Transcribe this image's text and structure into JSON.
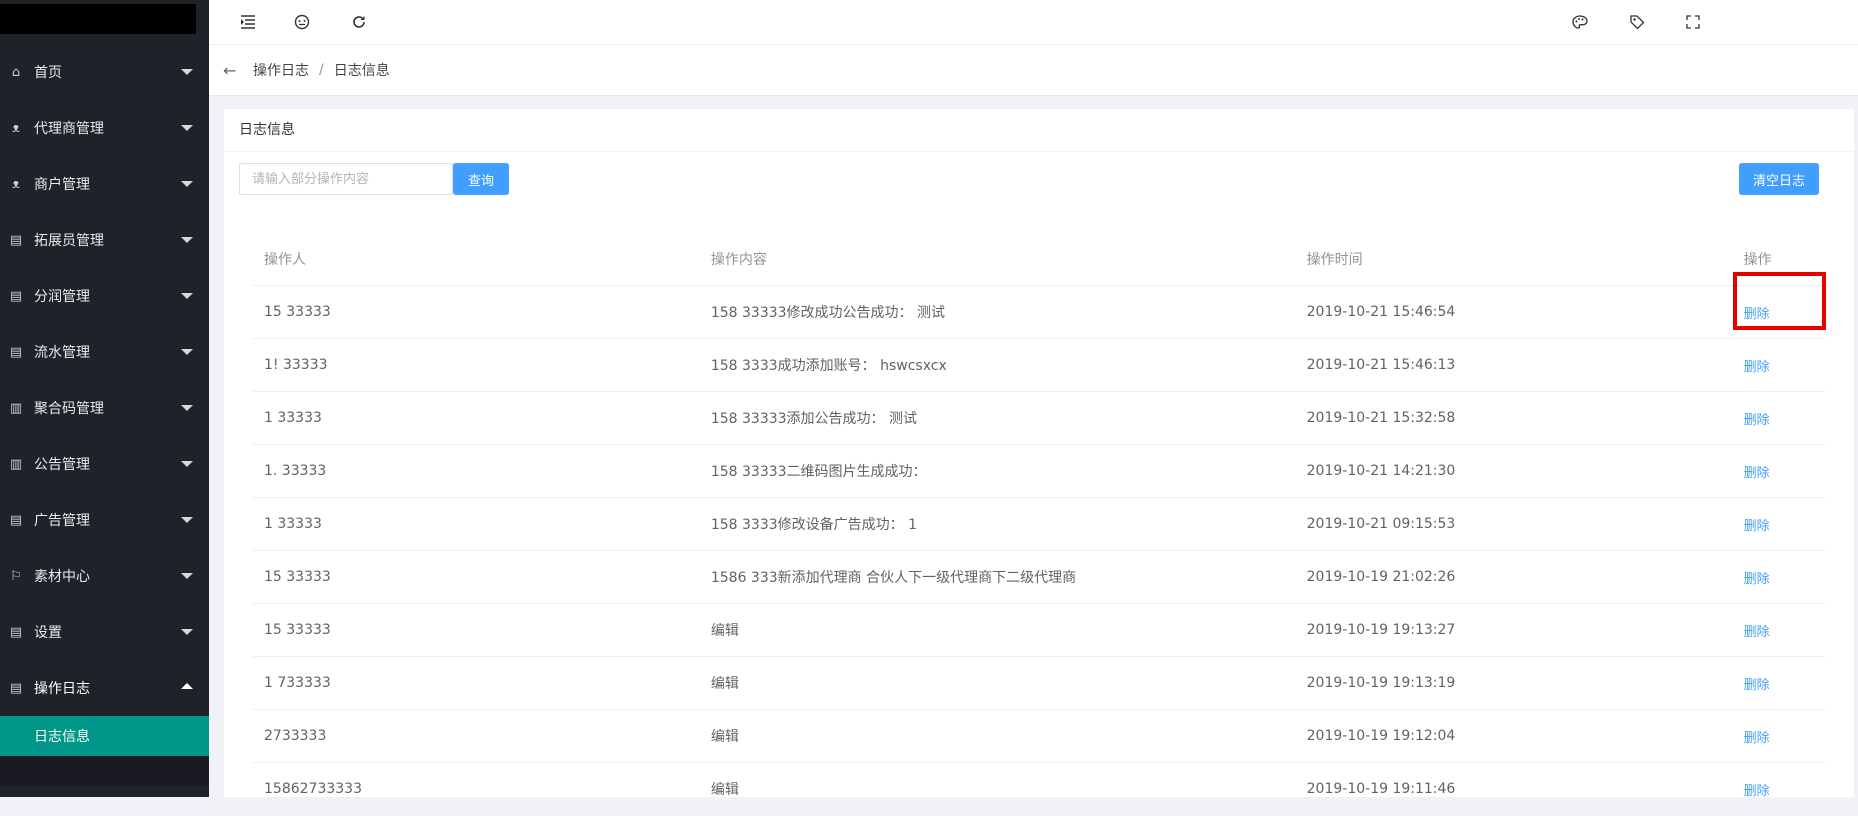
{
  "sidebar": {
    "items": [
      {
        "label": "首页",
        "icon": "home-icon",
        "glyph": "⌂"
      },
      {
        "label": "代理商管理",
        "icon": "user-icon",
        "glyph": "ᴥ"
      },
      {
        "label": "商户管理",
        "icon": "user-icon",
        "glyph": "ᴥ"
      },
      {
        "label": "拓展员管理",
        "icon": "clipboard-icon",
        "glyph": "▤"
      },
      {
        "label": "分润管理",
        "icon": "clipboard-icon",
        "glyph": "▤"
      },
      {
        "label": "流水管理",
        "icon": "clipboard-icon",
        "glyph": "▤"
      },
      {
        "label": "聚合码管理",
        "icon": "list-icon",
        "glyph": "▥"
      },
      {
        "label": "公告管理",
        "icon": "list-icon",
        "glyph": "▥"
      },
      {
        "label": "广告管理",
        "icon": "clipboard-icon",
        "glyph": "▤"
      },
      {
        "label": "素材中心",
        "icon": "flag-icon",
        "glyph": "⚐"
      },
      {
        "label": "设置",
        "icon": "clipboard-icon",
        "glyph": "▤"
      },
      {
        "label": "操作日志",
        "icon": "clipboard-icon",
        "glyph": "▤"
      }
    ],
    "submenu": {
      "label": "日志信息"
    }
  },
  "header": {
    "icons": [
      "menu-toggle-icon",
      "face-icon",
      "refresh-icon",
      "palette-icon",
      "tag-icon",
      "fullscreen-icon"
    ]
  },
  "breadcrumb": {
    "back": "←",
    "items": [
      "操作日志",
      "日志信息"
    ],
    "separator": "/"
  },
  "card": {
    "title": "日志信息",
    "search_placeholder": "请输入部分操作内容",
    "search_value": "",
    "query_button": "查询",
    "clear_button": "清空日志"
  },
  "table": {
    "columns": [
      "操作人",
      "操作内容",
      "操作时间",
      "操作"
    ],
    "rows": [
      {
        "operator": "15   33333",
        "content": "158  33333修改成功公告成功： 测试",
        "time": "2019-10-21 15:46:54",
        "action": "删除"
      },
      {
        "operator": "1!  33333",
        "content": "158  3333成功添加账号： hswcsxcx",
        "time": "2019-10-21 15:46:13",
        "action": "删除"
      },
      {
        "operator": "1   33333",
        "content": "158  33333添加公告成功： 测试",
        "time": "2019-10-21 15:32:58",
        "action": "删除"
      },
      {
        "operator": "1.  33333",
        "content": "158  33333二维码图片生成成功：",
        "time": "2019-10-21 14:21:30",
        "action": "删除"
      },
      {
        "operator": "1   33333",
        "content": "158  3333修改设备广告成功： 1",
        "time": "2019-10-21 09:15:53",
        "action": "删除"
      },
      {
        "operator": "15  33333",
        "content": "1586   333新添加代理商 合伙人下一级代理商下二级代理商",
        "time": "2019-10-19 21:02:26",
        "action": "删除"
      },
      {
        "operator": "15  33333",
        "content": "编辑",
        "time": "2019-10-19 19:13:27",
        "action": "删除"
      },
      {
        "operator": "1   733333",
        "content": "编辑",
        "time": "2019-10-19 19:13:19",
        "action": "删除"
      },
      {
        "operator": "   2733333",
        "content": "编辑",
        "time": "2019-10-19 19:12:04",
        "action": "删除"
      },
      {
        "operator": "15862733333",
        "content": "编辑",
        "time": "2019-10-19 19:11:46",
        "action": "删除"
      }
    ]
  },
  "colors": {
    "sidebar_bg": "#20222a",
    "active_submenu": "#009688",
    "primary": "#409eff",
    "highlight_box": "#e60000"
  }
}
